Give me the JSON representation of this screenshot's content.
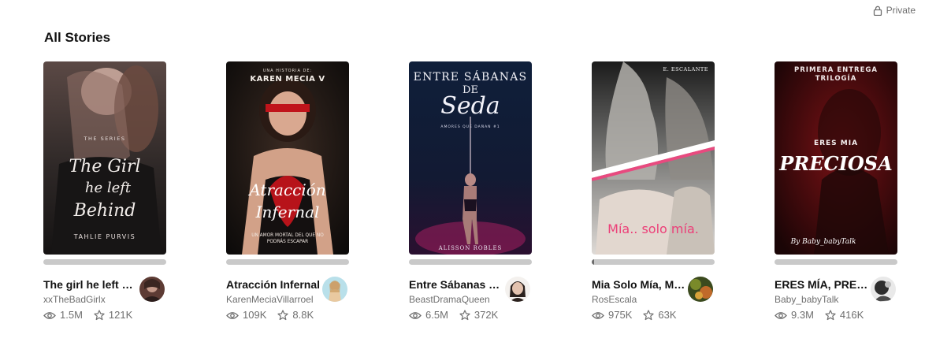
{
  "header": {
    "privacy_label": "Private",
    "section_title": "All Stories"
  },
  "stories": [
    {
      "title": "The girl he left Behind",
      "author": "xxTheBadGirlx",
      "reads": "1.5M",
      "votes": "121K",
      "progress": 0,
      "cover": {
        "kicker": "THE SERIES",
        "script_lines": [
          "The Girl",
          "he left",
          "Behind"
        ],
        "author": "TAHLIE PURVIS"
      }
    },
    {
      "title": "Atracción Infernal",
      "author": "KarenMeciaVillarroel",
      "reads": "109K",
      "votes": "8.8K",
      "progress": 0,
      "cover": {
        "kicker": "UNA HISTORIA DE:",
        "author": "KAREN MECIA V",
        "script_lines": [
          "Atracción",
          "Infernal"
        ],
        "tagline_lines": [
          "UN AMOR MORTAL DEL QUE NO",
          "PODRÁS ESCAPAR"
        ]
      }
    },
    {
      "title": "Entre Sábanas de Seda",
      "author": "BeastDramaQueen",
      "reads": "6.5M",
      "votes": "372K",
      "progress": 0,
      "cover": {
        "title_lines": [
          "ENTRE SÁBANAS",
          "DE"
        ],
        "script": "Seda",
        "series": "AMORES QUE DAÑAN #1",
        "author": "ALISSON ROBLES"
      }
    },
    {
      "title": "Mia Solo Mía, Mía solo mía",
      "author": "RosEscala",
      "reads": "975K",
      "votes": "63K",
      "progress": 0.02,
      "cover": {
        "author": "E. ESCALANTE",
        "script": "Mía.. solo mía."
      }
    },
    {
      "title": "ERES MÍA, PRECIOSA",
      "author": "Baby_babyTalk",
      "reads": "9.3M",
      "votes": "416K",
      "progress": 0,
      "cover": {
        "kicker_lines": [
          "PRIMERA ENTREGA",
          "TRILOGÍA"
        ],
        "subtitle": "ERES MIA",
        "script": "PRECIOSA",
        "author": "By Baby_babyTalk"
      }
    }
  ]
}
